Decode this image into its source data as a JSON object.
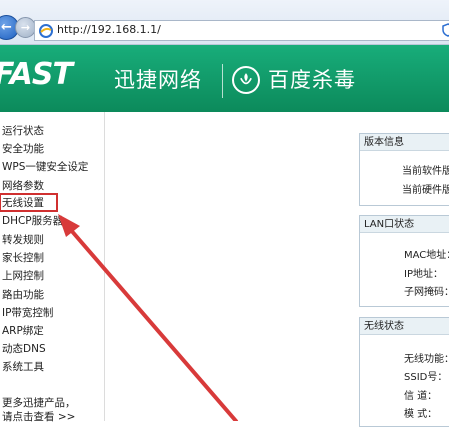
{
  "browser": {
    "address": "http://192.168.1.1/",
    "back_icon": "back-arrow-icon",
    "forward_icon": "forward-arrow-icon",
    "page_icon": "ie-page-icon",
    "secure_icon": "shield-icon"
  },
  "banner": {
    "brand": "FAST",
    "brand_cn": "迅捷网络",
    "partner_cn": "百度杀毒",
    "background_color": "#129c6a"
  },
  "sidebar": {
    "items": [
      {
        "label": "运行状态"
      },
      {
        "label": "安全功能"
      },
      {
        "label": "WPS一键安全设定"
      },
      {
        "label": "网络参数"
      },
      {
        "label": "无线设置",
        "highlighted": true
      },
      {
        "label": "DHCP服务器"
      },
      {
        "label": "转发规则"
      },
      {
        "label": "家长控制"
      },
      {
        "label": "上网控制"
      },
      {
        "label": "路由功能"
      },
      {
        "label": "IP带宽控制"
      },
      {
        "label": "ARP绑定"
      },
      {
        "label": "动态DNS"
      },
      {
        "label": "系统工具"
      }
    ],
    "more_line1": "更多迅捷产品，",
    "more_line2": "请点击查看 >>"
  },
  "panels": {
    "version": {
      "title": "版本信息",
      "rows": [
        "当前软件版",
        "当前硬件版"
      ]
    },
    "lan": {
      "title": "LAN口状态",
      "rows": [
        "MAC地址：",
        "IP地址：",
        "子网掩码："
      ]
    },
    "wireless": {
      "title": "无线状态",
      "rows": [
        "无线功能：",
        "SSID号：",
        "信 道：",
        "模 式："
      ]
    }
  },
  "annotation": {
    "highlight_color": "#d03030"
  }
}
